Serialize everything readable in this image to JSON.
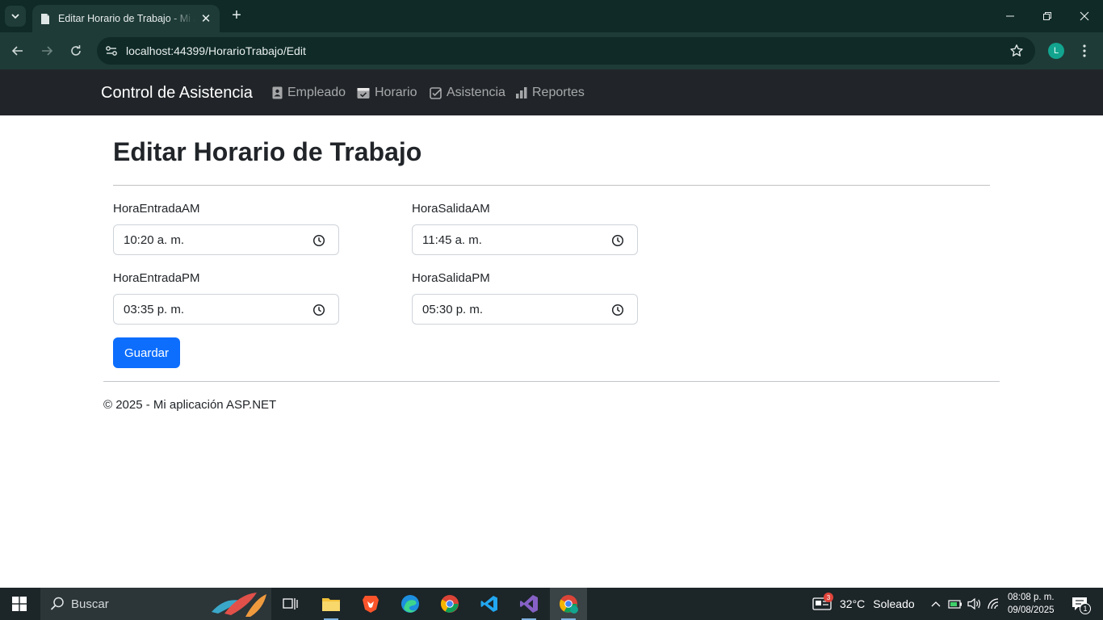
{
  "browser": {
    "tab_title": "Editar Horario de Trabajo - Mi aplicación ASP.NET",
    "url": "localhost:44399/HorarioTrabajo/Edit",
    "profile_initial": "L"
  },
  "navbar": {
    "brand": "Control de Asistencia",
    "items": [
      {
        "label": "Empleado",
        "icon": "id-badge-icon"
      },
      {
        "label": "Horario",
        "icon": "calendar-check-icon"
      },
      {
        "label": "Asistencia",
        "icon": "check-square-icon"
      },
      {
        "label": "Reportes",
        "icon": "bar-chart-icon"
      }
    ]
  },
  "form": {
    "title": "Editar Horario de Trabajo",
    "fields": {
      "entrada_am": {
        "label": "HoraEntradaAM",
        "value": "10:20  a. m."
      },
      "salida_am": {
        "label": "HoraSalidaAM",
        "value": "11:45  a. m."
      },
      "entrada_pm": {
        "label": "HoraEntradaPM",
        "value": "03:35  p. m."
      },
      "salida_pm": {
        "label": "HoraSalidaPM",
        "value": "05:30  p. m."
      }
    },
    "submit_label": "Guardar"
  },
  "footer": {
    "text": "© 2025 - Mi aplicación ASP.NET"
  },
  "taskbar": {
    "search_placeholder": "Buscar",
    "weather": {
      "temp": "32°C",
      "condition": "Soleado",
      "badge": "3"
    },
    "time": "08:08 p. m.",
    "date": "09/08/2025",
    "notification_count": "1"
  },
  "colors": {
    "primary": "#0d6efd",
    "navbar_bg": "#212529",
    "chrome_bg": "#1e3b37"
  }
}
